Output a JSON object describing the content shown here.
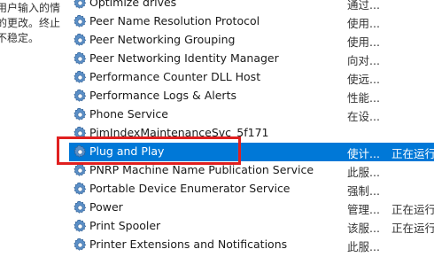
{
  "description_pane": {
    "lines": [
      "用户输入的情",
      "的更改。终止",
      "不稳定。"
    ]
  },
  "services": [
    {
      "name": "Optimize drives",
      "desc": "通过...",
      "status": ""
    },
    {
      "name": "Peer Name Resolution Protocol",
      "desc": "使用...",
      "status": ""
    },
    {
      "name": "Peer Networking Grouping",
      "desc": "使用...",
      "status": ""
    },
    {
      "name": "Peer Networking Identity Manager",
      "desc": "向对...",
      "status": ""
    },
    {
      "name": "Performance Counter DLL Host",
      "desc": "使远...",
      "status": ""
    },
    {
      "name": "Performance Logs & Alerts",
      "desc": "性能...",
      "status": ""
    },
    {
      "name": "Phone Service",
      "desc": "在设...",
      "status": ""
    },
    {
      "name": "PimIndexMaintenanceSvc_5f171",
      "desc": "",
      "status": ""
    },
    {
      "name": "Plug and Play",
      "desc": "使计...",
      "status": "正在运行"
    },
    {
      "name": "PNRP Machine Name Publication Service",
      "desc": "此服...",
      "status": ""
    },
    {
      "name": "Portable Device Enumerator Service",
      "desc": "强制...",
      "status": ""
    },
    {
      "name": "Power",
      "desc": "管理...",
      "status": "正在运行"
    },
    {
      "name": "Print Spooler",
      "desc": "该服...",
      "status": "正在运行"
    },
    {
      "name": "Printer Extensions and Notifications",
      "desc": "此服...",
      "status": ""
    }
  ],
  "selected_index": 8,
  "icon_name": "gear-service-icon",
  "colors": {
    "selection": "#0078d7",
    "highlight_box": "#e02020"
  }
}
